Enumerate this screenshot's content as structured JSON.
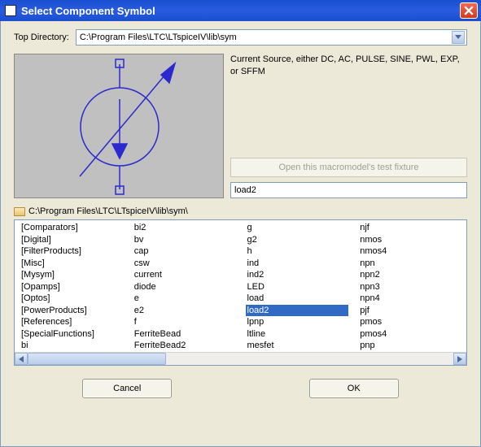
{
  "window": {
    "title": "Select Component Symbol"
  },
  "topdir": {
    "label": "Top Directory:",
    "value": "C:\\Program Files\\LTC\\LTspiceIV\\lib\\sym"
  },
  "description": "Current Source, either DC, AC, PULSE, SINE, PWL, EXP, or SFFM",
  "macromodel_button": "Open this macromodel's test fixture",
  "search_value": "load2",
  "path_display": "C:\\Program Files\\LTC\\LTspiceIV\\lib\\sym\\",
  "selected_item": "load2",
  "columns": [
    [
      "[Comparators]",
      "[Digital]",
      "[FilterProducts]",
      "[Misc]",
      "[Mysym]",
      "[Opamps]",
      "[Optos]",
      "[PowerProducts]",
      "[References]",
      "[SpecialFunctions]",
      "bi"
    ],
    [
      "bi2",
      "bv",
      "cap",
      "csw",
      "current",
      "diode",
      "e",
      "e2",
      "f",
      "FerriteBead",
      "FerriteBead2"
    ],
    [
      "g",
      "g2",
      "h",
      "ind",
      "ind2",
      "LED",
      "load",
      "load2",
      "lpnp",
      "ltline",
      "mesfet"
    ],
    [
      "njf",
      "nmos",
      "nmos4",
      "npn",
      "npn2",
      "npn3",
      "npn4",
      "pjf",
      "pmos",
      "pmos4",
      "pnp"
    ]
  ],
  "buttons": {
    "cancel": "Cancel",
    "ok": "OK"
  }
}
